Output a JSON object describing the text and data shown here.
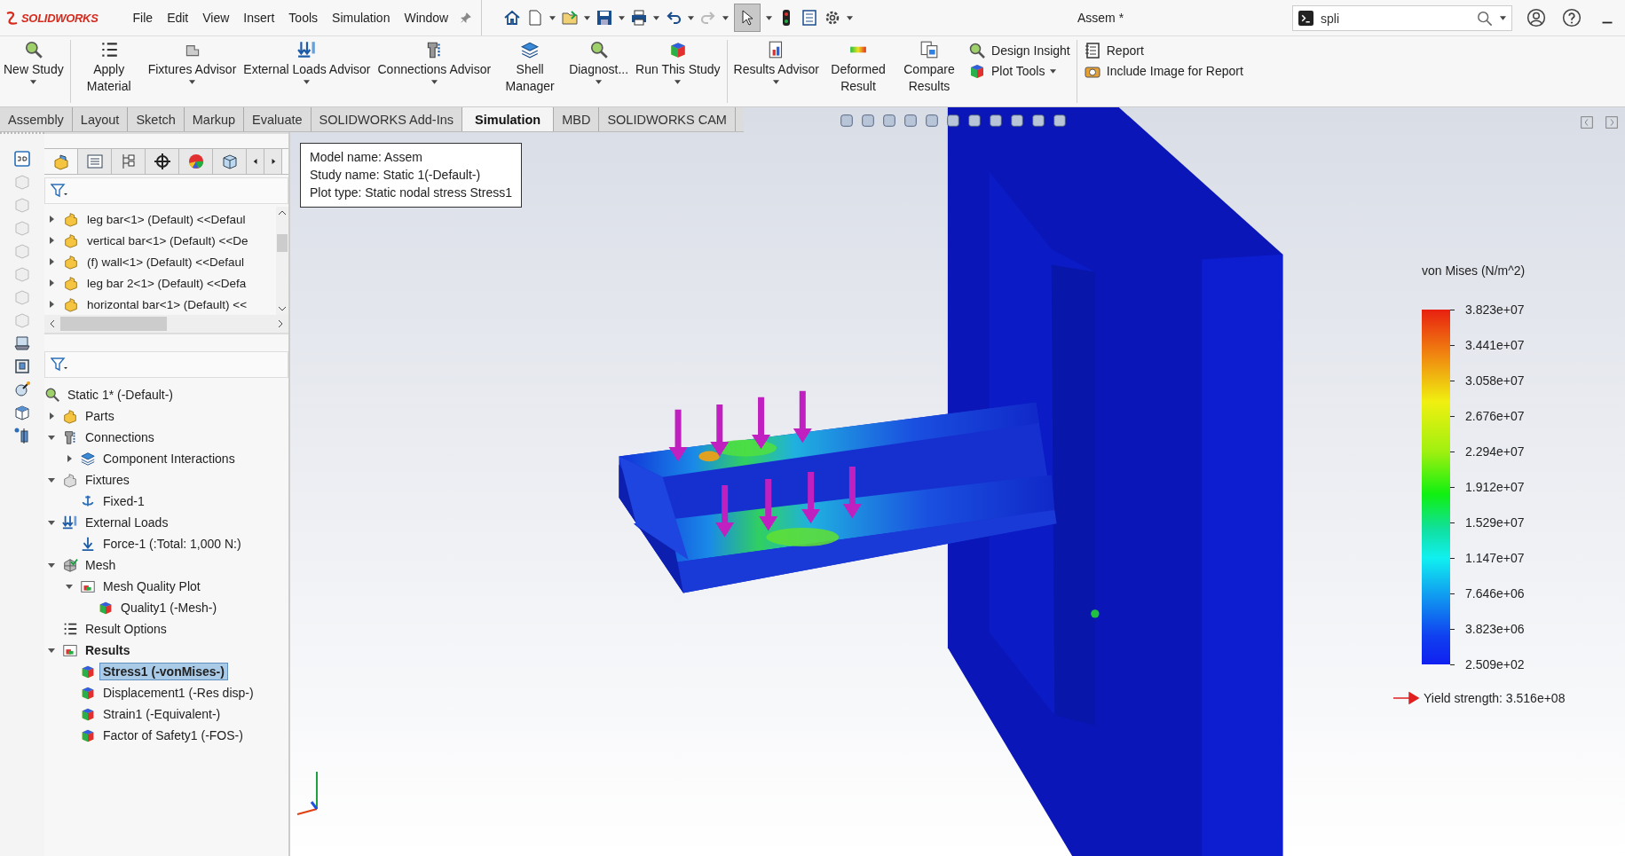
{
  "app": {
    "logo": "SOLIDWORKS"
  },
  "menu": [
    "File",
    "Edit",
    "View",
    "Insert",
    "Tools",
    "Simulation",
    "Window"
  ],
  "window": {
    "title": "Assem *"
  },
  "search": {
    "value": "spli"
  },
  "ribbon": [
    {
      "kind": "large",
      "label": "New Study",
      "dropdown": true
    },
    {
      "kind": "large",
      "label": "Apply Material",
      "dropdown": false
    },
    {
      "kind": "large",
      "label": "Fixtures Advisor",
      "dropdown": true
    },
    {
      "kind": "large",
      "label": "External Loads Advisor",
      "dropdown": true
    },
    {
      "kind": "large",
      "label": "Connections Advisor",
      "dropdown": true
    },
    {
      "kind": "large",
      "label": "Shell Manager",
      "dropdown": false
    },
    {
      "kind": "large",
      "label": "Diagnost...",
      "dropdown": true
    },
    {
      "kind": "large",
      "label": "Run This Study",
      "dropdown": true
    },
    {
      "kind": "large",
      "label": "Results Advisor",
      "dropdown": true
    },
    {
      "kind": "large",
      "label": "Deformed Result",
      "dropdown": false
    },
    {
      "kind": "large",
      "label": "Compare Results",
      "dropdown": false
    },
    {
      "kind": "stack",
      "items": [
        {
          "label": "Design Insight",
          "dropdown": false
        },
        {
          "label": "Plot Tools",
          "dropdown": true
        }
      ]
    },
    {
      "kind": "stack",
      "items": [
        {
          "label": "Report",
          "dropdown": false
        },
        {
          "label": "Include Image for Report",
          "dropdown": false
        }
      ]
    }
  ],
  "tabs": [
    {
      "label": "Assembly",
      "selected": false
    },
    {
      "label": "Layout",
      "selected": false
    },
    {
      "label": "Sketch",
      "selected": false
    },
    {
      "label": "Markup",
      "selected": false
    },
    {
      "label": "Evaluate",
      "selected": false
    },
    {
      "label": "SOLIDWORKS Add-Ins",
      "selected": false
    },
    {
      "label": "Simulation",
      "selected": true
    },
    {
      "label": "MBD",
      "selected": false
    },
    {
      "label": "SOLIDWORKS CAM",
      "selected": false
    }
  ],
  "component_tree": [
    {
      "label": "leg bar<1> (Default) <<Defaul",
      "expanded": false
    },
    {
      "label": "vertical bar<1> (Default) <<De",
      "expanded": false
    },
    {
      "label": "(f) wall<1> (Default) <<Defaul",
      "expanded": false
    },
    {
      "label": "leg bar 2<1> (Default) <<Defa",
      "expanded": false
    },
    {
      "label": "horizontal bar<1> (Default) <<",
      "expanded": false
    }
  ],
  "study_tree": {
    "label": "Static 1* (-Default-)",
    "kind": "study",
    "selected": false,
    "children": [
      {
        "label": "Parts",
        "kind": "parts",
        "expanded": false,
        "selected": false
      },
      {
        "label": "Connections",
        "kind": "connections",
        "expanded": true,
        "selected": false,
        "children": [
          {
            "label": "Component Interactions",
            "kind": "interaction",
            "expanded": false,
            "selected": false
          }
        ]
      },
      {
        "label": "Fixtures",
        "kind": "fixtures",
        "expanded": true,
        "selected": false,
        "children": [
          {
            "label": "Fixed-1",
            "kind": "fixed",
            "selected": false
          }
        ]
      },
      {
        "label": "External Loads",
        "kind": "loads",
        "expanded": true,
        "selected": false,
        "children": [
          {
            "label": "Force-1 (:Total: 1,000 N:)",
            "kind": "force",
            "selected": false
          }
        ]
      },
      {
        "label": "Mesh",
        "kind": "mesh",
        "expanded": true,
        "selected": false,
        "children": [
          {
            "label": "Mesh Quality Plot",
            "kind": "folder",
            "expanded": true,
            "selected": false,
            "children": [
              {
                "label": "Quality1 (-Mesh-)",
                "kind": "plot",
                "selected": false
              }
            ]
          }
        ]
      },
      {
        "label": "Result Options",
        "kind": "options",
        "selected": false
      },
      {
        "label": "Results",
        "kind": "folder",
        "expanded": true,
        "bold": true,
        "selected": false,
        "children": [
          {
            "label": "Stress1 (-vonMises-)",
            "kind": "plot",
            "selected": true
          },
          {
            "label": "Displacement1 (-Res disp-)",
            "kind": "plot",
            "selected": false
          },
          {
            "label": "Strain1 (-Equivalent-)",
            "kind": "plot",
            "selected": false
          },
          {
            "label": "Factor of Safety1 (-FOS-)",
            "kind": "plot",
            "selected": false
          }
        ]
      }
    ]
  },
  "info_box": [
    "Model name: Assem",
    "Study name: Static 1(-Default-)",
    "Plot type: Static nodal stress Stress1"
  ],
  "legend": {
    "title": "von Mises (N/m^2)",
    "ticks": [
      "3.823e+07",
      "3.441e+07",
      "3.058e+07",
      "2.676e+07",
      "2.294e+07",
      "1.912e+07",
      "1.529e+07",
      "1.147e+07",
      "7.646e+06",
      "3.823e+06",
      "2.509e+02"
    ],
    "yield": "Yield strength: 3.516e+08"
  }
}
